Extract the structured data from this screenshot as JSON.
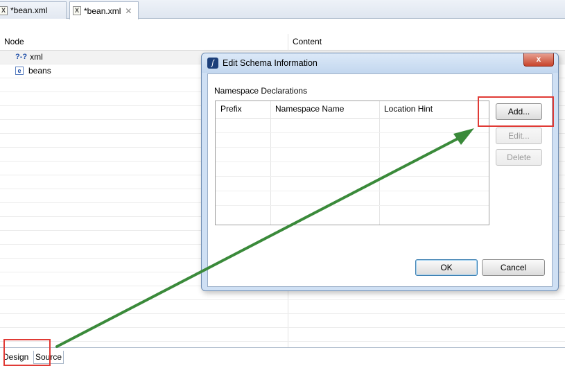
{
  "tabs": [
    {
      "label": "*bean.xml",
      "icon": "xml-file-icon",
      "active": false
    },
    {
      "label": "*bean.xml",
      "icon": "xml-file-icon",
      "active": true,
      "close": "✕"
    }
  ],
  "tree": {
    "columns": {
      "node": "Node",
      "content": "Content"
    },
    "rows": [
      {
        "icon": "processing-instruction-icon",
        "icon_glyph": "?-?",
        "label": "xml"
      },
      {
        "icon": "element-icon",
        "icon_glyph": "e",
        "label": "beans"
      }
    ]
  },
  "bottom_tabs": [
    {
      "label": "Design"
    },
    {
      "label": "Source"
    }
  ],
  "dialog": {
    "title": "Edit Schema Information",
    "close_glyph": "x",
    "section": "Namespace Declarations",
    "columns": [
      "Prefix",
      "Namespace Name",
      "Location Hint"
    ],
    "buttons": {
      "add": "Add...",
      "edit": "Edit...",
      "delete": "Delete",
      "ok": "OK",
      "cancel": "Cancel"
    }
  },
  "colors": {
    "annotation_red": "#e03a35",
    "annotation_arrow": "#3a8a3a",
    "dialog_frame": "#cfe0f4"
  }
}
